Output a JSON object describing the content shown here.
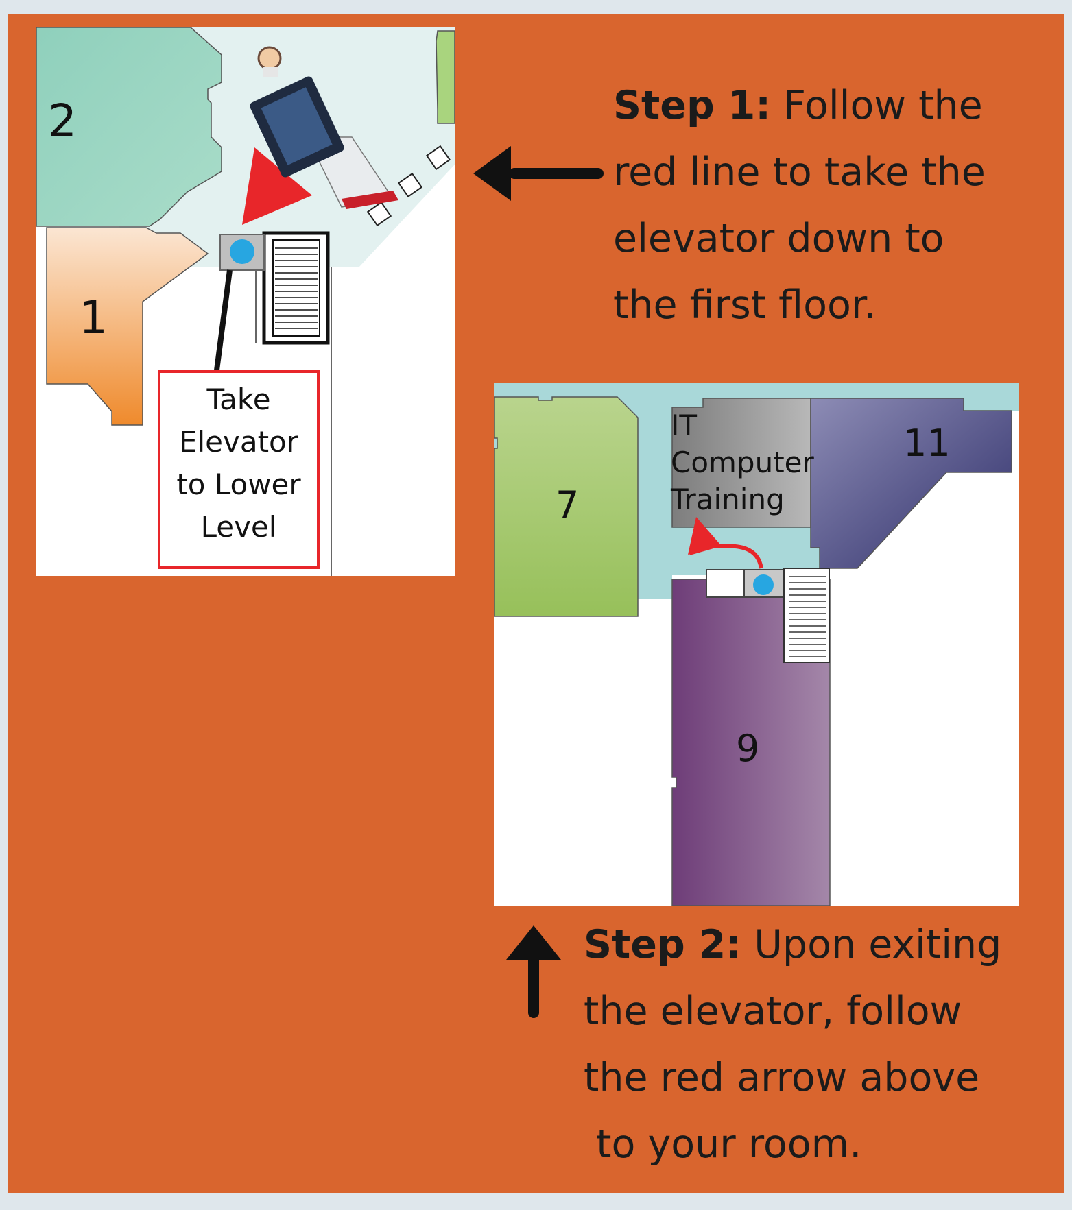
{
  "map_upper": {
    "room_labels": [
      "2",
      "1"
    ],
    "callout_lines": [
      "Take",
      "Elevator",
      "to Lower",
      "Level"
    ]
  },
  "map_lower": {
    "room_labels": [
      "7",
      "11",
      "9"
    ],
    "room_it_lines": [
      "IT",
      "Computer",
      "Training"
    ]
  },
  "step1": {
    "lead": "Step 1:",
    "lines": [
      "Follow the",
      "red line to take the",
      "elevator down to",
      "the first floor."
    ]
  },
  "step2": {
    "lead": "Step 2:",
    "lines": [
      "Upon exiting",
      "the elevator, follow",
      "the red arrow above",
      " to your room."
    ]
  },
  "colors": {
    "background": "#d9652e",
    "route_red": "#e8262a",
    "elevator_dot": "#27a6e1",
    "corridor": "#a9d8d9"
  }
}
